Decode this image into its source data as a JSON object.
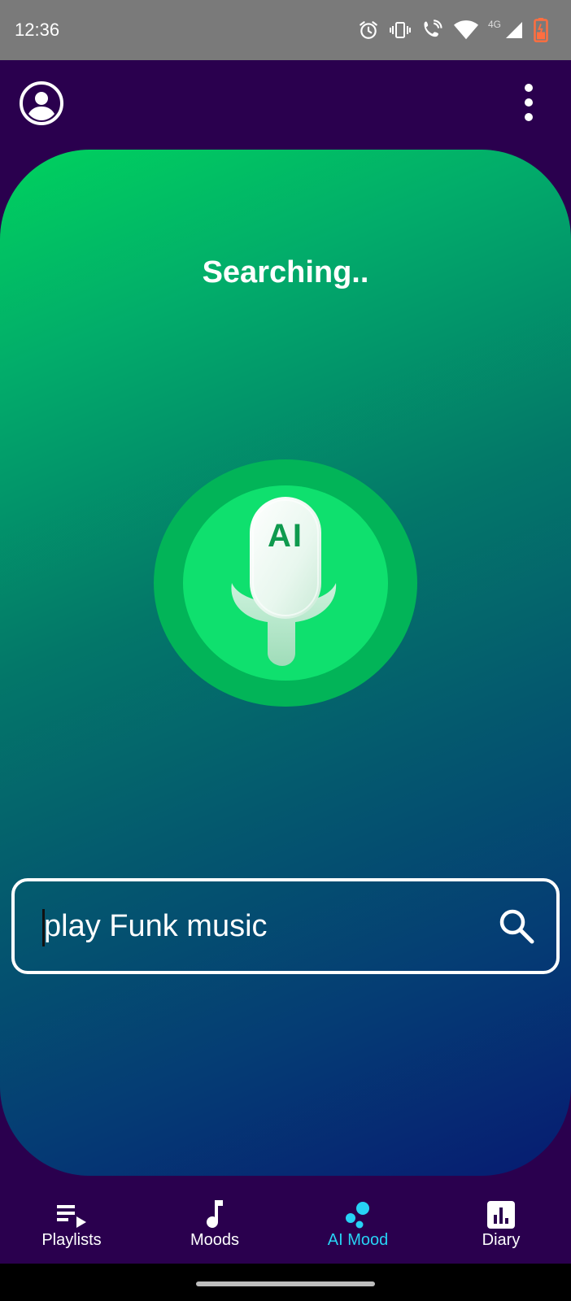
{
  "status_bar": {
    "time": "12:36",
    "network_type": "4G",
    "icons": [
      "alarm-icon",
      "vibrate-icon",
      "wifi-call-icon",
      "wifi-icon",
      "signal-icon",
      "battery-icon"
    ],
    "battery_color": "#ff6e40"
  },
  "top_bar": {
    "icons": [
      "account-circle-icon",
      "more-vert-icon"
    ]
  },
  "main": {
    "status_title": "Searching..",
    "mic_badge_text": "AI",
    "gradient_colors": [
      "#00d25e",
      "#037769",
      "#061b72"
    ]
  },
  "search": {
    "value": "play Funk music",
    "icon": "search-icon"
  },
  "bottom_nav": {
    "active_color": "#27d3f5",
    "items": [
      {
        "label": "Playlists",
        "icon": "playlist-play-icon",
        "active": false
      },
      {
        "label": "Moods",
        "icon": "music-note-icon",
        "active": false
      },
      {
        "label": "AI Mood",
        "icon": "bubbles-icon",
        "active": true
      },
      {
        "label": "Diary",
        "icon": "bar-chart-icon",
        "active": false
      }
    ]
  }
}
